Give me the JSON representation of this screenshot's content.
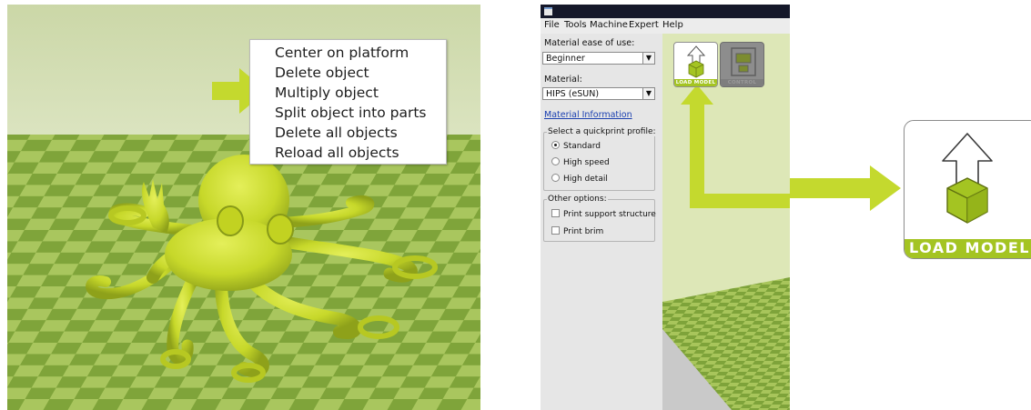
{
  "context_menu": {
    "items": [
      "Center on platform",
      "Delete object",
      "Multiply object",
      "Split object into parts",
      "Delete all objects",
      "Reload all objects"
    ]
  },
  "cura": {
    "menu": [
      "File",
      "Tools",
      "Machine",
      "Expert",
      "Help"
    ],
    "ease_label": "Material ease of use:",
    "ease_value": "Beginner",
    "material_label": "Material:",
    "material_value": "HIPS (eSUN)",
    "material_info_link": "Material Information",
    "profile_group_title": "Select a quickprint profile:",
    "profiles": [
      {
        "label": "Standard",
        "selected": true
      },
      {
        "label": "High speed",
        "selected": false
      },
      {
        "label": "High detail",
        "selected": false
      }
    ],
    "options_group_title": "Other options:",
    "options": [
      {
        "label": "Print support structure",
        "checked": false
      },
      {
        "label": "Print brim",
        "checked": false
      }
    ],
    "load_model_label": "LOAD MODEL",
    "control_label": "CONTROL"
  },
  "big_icon": {
    "label": "LOAD MODEL"
  },
  "colors": {
    "accent_green": "#a4c422",
    "arrow_green": "#c4d92e",
    "checker_light": "#a9c65e",
    "checker_dark": "#7fa43a",
    "sky": "#d3ddb5",
    "model": "#d7e52f"
  }
}
